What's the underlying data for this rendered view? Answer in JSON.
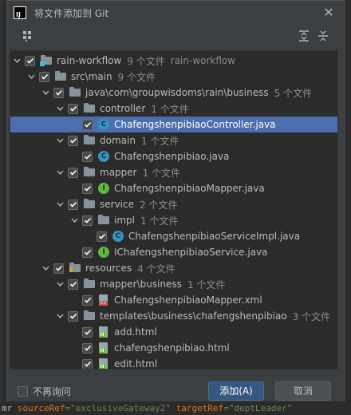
{
  "dialog": {
    "title": "将文件添加到 Git",
    "app_icon_text": "IJ",
    "close_glyph": "✕"
  },
  "tree": {
    "rows": [
      {
        "label": "rain-workflow",
        "meta": "9 个文件",
        "meta2": "rain-workflow",
        "icon": "module-folder-icon",
        "expanded": true,
        "checked": true
      },
      {
        "label": "src\\main",
        "meta": "9 个文件",
        "meta2": "",
        "icon": "folder-icon",
        "expanded": true,
        "checked": true
      },
      {
        "label": "java\\com\\groupwisdoms\\rain\\business",
        "meta": "5 个文件",
        "meta2": "",
        "icon": "folder-icon",
        "expanded": true,
        "checked": true
      },
      {
        "label": "controller",
        "meta": "1 个文件",
        "meta2": "",
        "icon": "folder-icon",
        "expanded": true,
        "checked": true
      },
      {
        "label": "ChafengshenpibiaoController.java",
        "meta": "",
        "meta2": "",
        "icon": "java-class-icon",
        "expanded": null,
        "checked": true,
        "selected": true
      },
      {
        "label": "domain",
        "meta": "1 个文件",
        "meta2": "",
        "icon": "folder-icon",
        "expanded": true,
        "checked": true
      },
      {
        "label": "Chafengshenpibiao.java",
        "meta": "",
        "meta2": "",
        "icon": "java-class-icon",
        "expanded": null,
        "checked": true
      },
      {
        "label": "mapper",
        "meta": "1 个文件",
        "meta2": "",
        "icon": "folder-icon",
        "expanded": true,
        "checked": true
      },
      {
        "label": "ChafengshenpibiaoMapper.java",
        "meta": "",
        "meta2": "",
        "icon": "java-interface-icon",
        "expanded": null,
        "checked": true
      },
      {
        "label": "service",
        "meta": "2 个文件",
        "meta2": "",
        "icon": "folder-icon",
        "expanded": true,
        "checked": true
      },
      {
        "label": "impl",
        "meta": "1 个文件",
        "meta2": "",
        "icon": "folder-icon",
        "expanded": true,
        "checked": true
      },
      {
        "label": "ChafengshenpibiaoServiceImpl.java",
        "meta": "",
        "meta2": "",
        "icon": "java-class-icon",
        "expanded": null,
        "checked": true
      },
      {
        "label": "IChafengshenpibiaoService.java",
        "meta": "",
        "meta2": "",
        "icon": "java-interface-icon",
        "expanded": null,
        "checked": true
      },
      {
        "label": "resources",
        "meta": "4 个文件",
        "meta2": "",
        "icon": "resources-folder-icon",
        "expanded": true,
        "checked": true
      },
      {
        "label": "mapper\\business",
        "meta": "1 个文件",
        "meta2": "",
        "icon": "folder-icon",
        "expanded": true,
        "checked": true
      },
      {
        "label": "ChafengshenpibiaoMapper.xml",
        "meta": "",
        "meta2": "",
        "icon": "xml-file-icon",
        "expanded": null,
        "checked": true
      },
      {
        "label": "templates\\business\\chafengshenpibiao",
        "meta": "3 个文件",
        "meta2": "",
        "icon": "folder-icon",
        "expanded": true,
        "checked": true
      },
      {
        "label": "add.html",
        "meta": "",
        "meta2": "",
        "icon": "html-file-icon",
        "expanded": null,
        "checked": true
      },
      {
        "label": "chafengshenpibiao.html",
        "meta": "",
        "meta2": "",
        "icon": "html-file-icon",
        "expanded": null,
        "checked": true
      },
      {
        "label": "edit.html",
        "meta": "",
        "meta2": "",
        "icon": "html-file-icon",
        "expanded": null,
        "checked": true
      }
    ]
  },
  "footer": {
    "dont_ask_label": "不再询问",
    "dont_ask_checked": false,
    "add_label": "添加(A)",
    "cancel_label": "取消"
  },
  "colors": {
    "dialog_bg": "#3c3f41",
    "tree_bg": "#2b2b2b",
    "selection": "#4b6eaf",
    "primary_button": "#365880"
  }
}
